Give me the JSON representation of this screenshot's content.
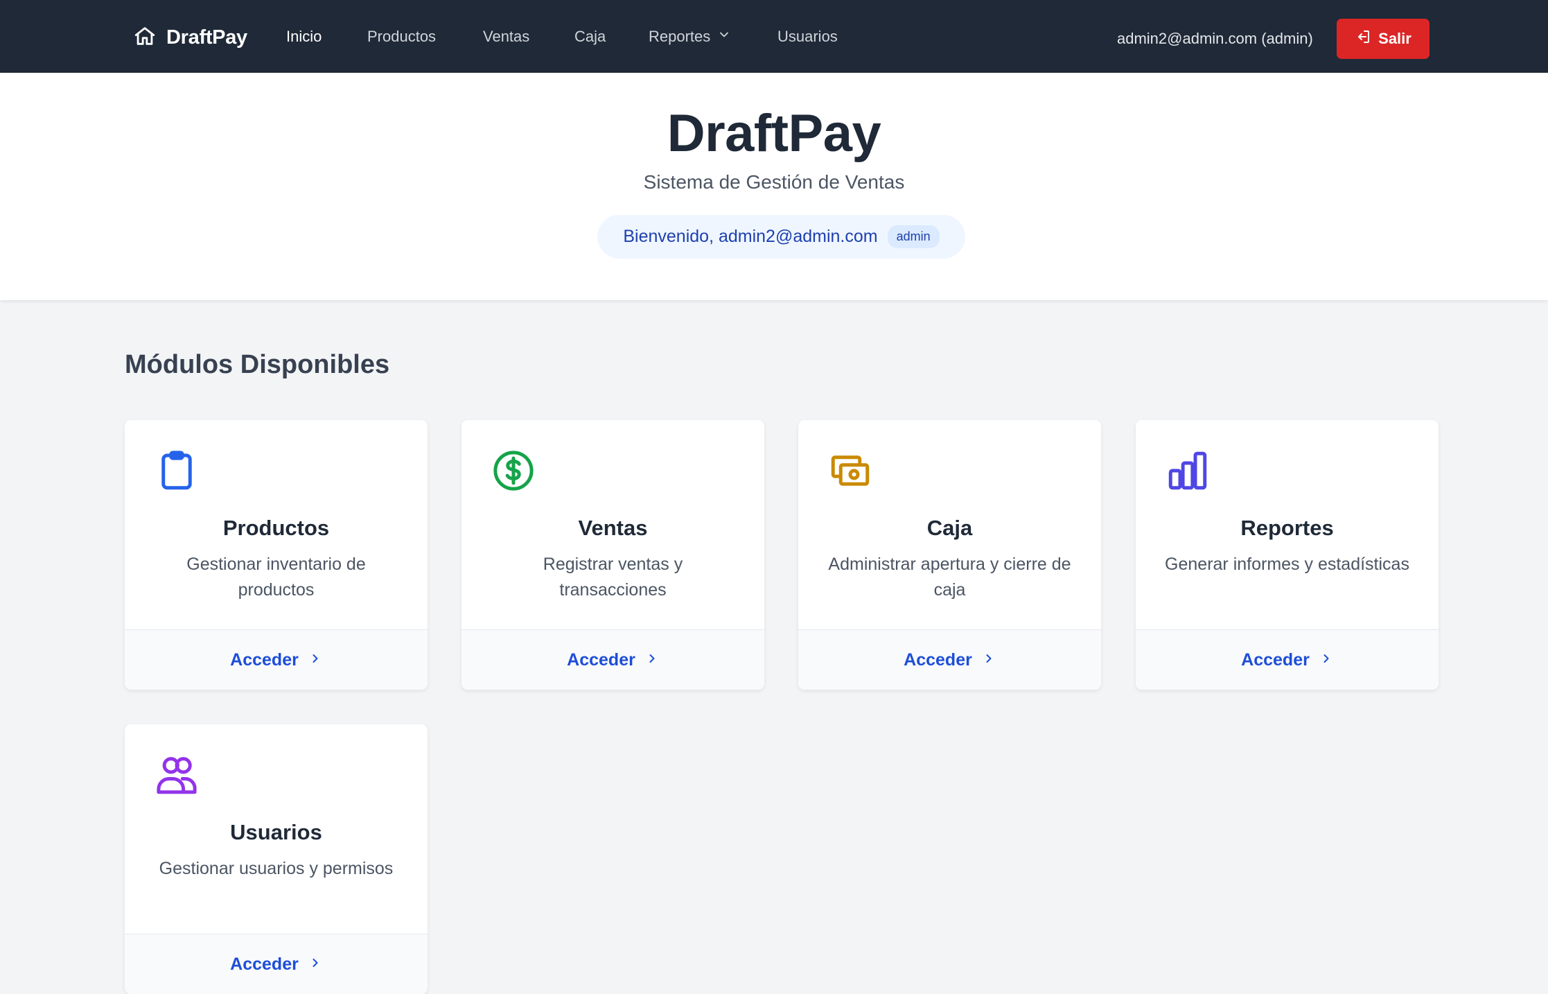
{
  "navbar": {
    "brand": "DraftPay",
    "links": [
      {
        "label": "Inicio"
      },
      {
        "label": "Productos"
      },
      {
        "label": "Ventas"
      },
      {
        "label": "Caja"
      },
      {
        "label": "Reportes"
      },
      {
        "label": "Usuarios"
      }
    ],
    "user_label": "admin2@admin.com (admin)",
    "logout_label": "Salir"
  },
  "hero": {
    "title": "DraftPay",
    "subtitle": "Sistema de Gestión de Ventas",
    "welcome": "Bienvenido, admin2@admin.com",
    "role": "admin"
  },
  "modules": {
    "title": "Módulos Disponibles",
    "items": [
      {
        "title": "Productos",
        "description": "Gestionar inventario de productos",
        "action": "Acceder",
        "icon": "clipboard-icon",
        "color": "#2563eb"
      },
      {
        "title": "Ventas",
        "description": "Registrar ventas y transacciones",
        "action": "Acceder",
        "icon": "dollar-circle-icon",
        "color": "#16a34a"
      },
      {
        "title": "Caja",
        "description": "Administrar apertura y cierre de caja",
        "action": "Acceder",
        "icon": "cash-icon",
        "color": "#ca8a04"
      },
      {
        "title": "Reportes",
        "description": "Generar informes y estadísticas",
        "action": "Acceder",
        "icon": "bar-chart-icon",
        "color": "#4f46e5"
      },
      {
        "title": "Usuarios",
        "description": "Gestionar usuarios y permisos",
        "action": "Acceder",
        "icon": "users-icon",
        "color": "#9333ea"
      }
    ]
  }
}
